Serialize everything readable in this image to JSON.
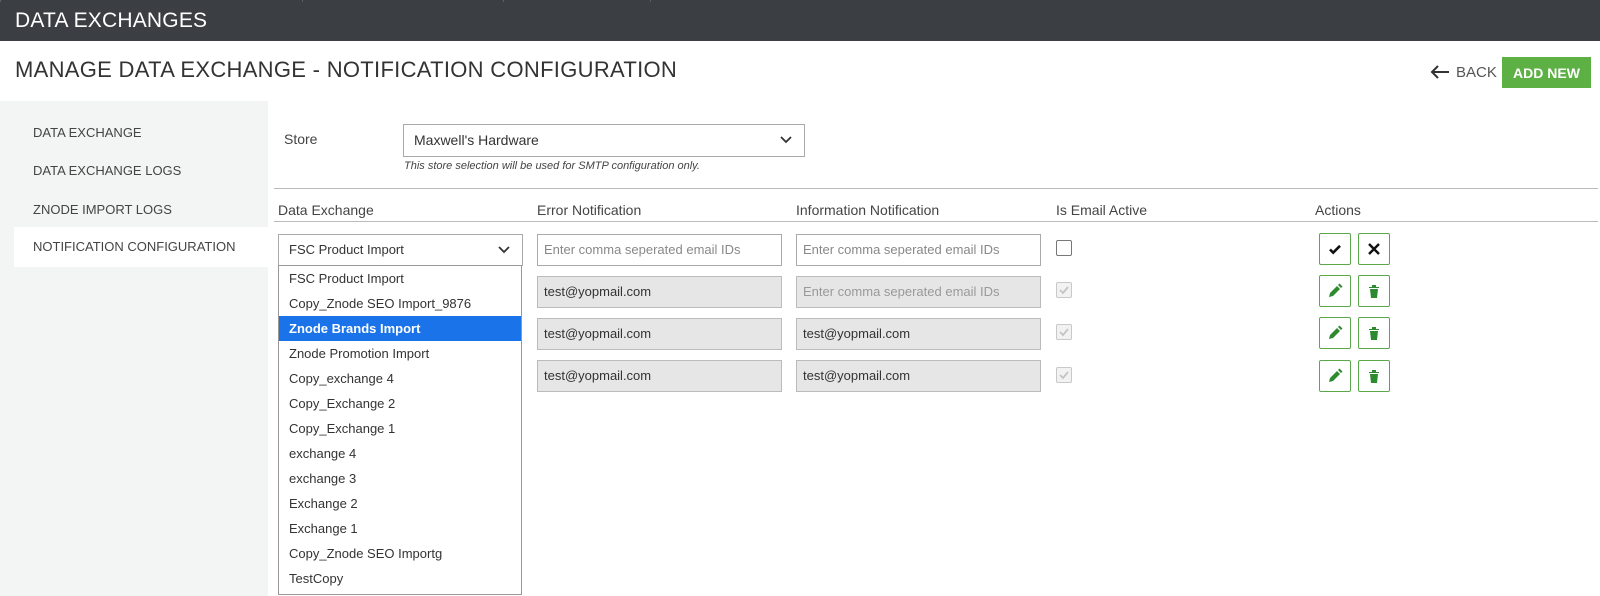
{
  "app": {
    "title": "DATA EXCHANGES"
  },
  "header": {
    "title": "MANAGE DATA EXCHANGE - NOTIFICATION CONFIGURATION",
    "back_label": "BACK",
    "add_label": "ADD NEW"
  },
  "sidebar": {
    "items": [
      {
        "label": "DATA EXCHANGE"
      },
      {
        "label": "DATA EXCHANGE LOGS"
      },
      {
        "label": "ZNODE IMPORT LOGS"
      },
      {
        "label": "NOTIFICATION CONFIGURATION"
      }
    ]
  },
  "store": {
    "label": "Store",
    "value": "Maxwell's Hardware",
    "hint": "This store selection will be used for SMTP configuration only."
  },
  "table": {
    "columns": [
      "Data Exchange",
      "Error Notification",
      "Information Notification",
      "Is Email Active",
      "Actions"
    ],
    "edit_row": {
      "data_exchange": "FSC Product Import",
      "error_placeholder": "Enter comma seperated email IDs",
      "info_placeholder": "Enter comma seperated email IDs"
    },
    "rows": [
      {
        "error": "test@yopmail.com",
        "info": "",
        "info_placeholder": "Enter comma seperated email IDs",
        "active": true
      },
      {
        "error": "test@yopmail.com",
        "info": "test@yopmail.com",
        "info_placeholder": "",
        "active": true
      },
      {
        "error": "test@yopmail.com",
        "info": "test@yopmail.com",
        "info_placeholder": "",
        "active": true
      }
    ]
  },
  "dropdown": {
    "options": [
      "FSC Product Import",
      "Copy_Znode SEO Import_9876",
      "Znode Brands Import",
      "Znode Promotion Import",
      "Copy_exchange 4",
      "Copy_Exchange 2",
      "Copy_Exchange 1",
      "exchange 4",
      "exchange 3",
      "Exchange 2",
      "Exchange 1",
      "Copy_Znode SEO Importg",
      "TestCopy"
    ],
    "highlighted": "Znode Brands Import"
  },
  "colors": {
    "accent": "#5cb044",
    "topbar": "#3b3f43",
    "highlight": "#1a73e8"
  }
}
